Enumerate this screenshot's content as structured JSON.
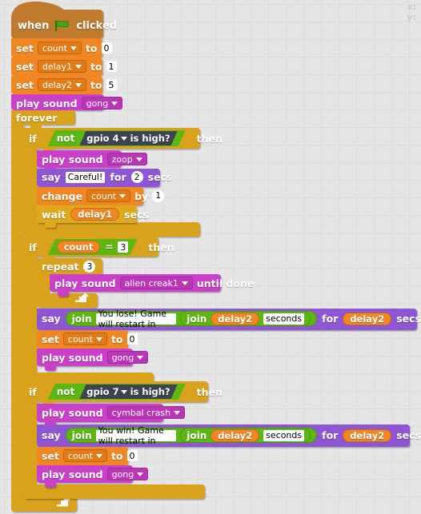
{
  "stage": {
    "x_label": "x:",
    "y_label": "y:",
    "x_value": "",
    "y_value": ""
  },
  "palette_colors": {
    "events_hat": "#bf7a2e",
    "control": "#d9a21c",
    "data": "#f08724",
    "sound": "#cb3fc9",
    "looks": "#8f57d3",
    "operators": "#5cb712",
    "sensing_gpio": "#3d4450",
    "background": "#e5e5e5"
  },
  "script": {
    "hat": {
      "when": "when",
      "icon": "green-flag-icon",
      "clicked": "clicked"
    },
    "set_count_0": {
      "op": "set",
      "var": "count",
      "to": "to",
      "value": "0"
    },
    "set_delay1_1": {
      "op": "set",
      "var": "delay1",
      "to": "to",
      "value": "1"
    },
    "set_delay2_5": {
      "op": "set",
      "var": "delay2",
      "to": "to",
      "value": "5"
    },
    "play_gong_top": {
      "op": "play sound",
      "sound": "gong"
    },
    "forever": {
      "label": "forever"
    },
    "if1": {
      "if": "if",
      "then": "then",
      "not": "not",
      "gpio": "gpio",
      "pin": "4",
      "is_high": "is  high?",
      "play_zoop": {
        "op": "play sound",
        "sound": "zoop"
      },
      "say_careful": {
        "op": "say",
        "message": "Careful!",
        "for": "for",
        "secs_value": "2",
        "secs": "secs"
      },
      "change_count": {
        "op": "change",
        "var": "count",
        "by": "by",
        "value": "1"
      },
      "wait_delay1": {
        "op": "wait",
        "var": "delay1",
        "secs": "secs"
      }
    },
    "if2": {
      "if": "if",
      "then": "then",
      "var": "count",
      "operator": "=",
      "value": "3",
      "repeat": {
        "op": "repeat",
        "times": "3"
      },
      "play_alien": {
        "op": "play sound",
        "sound": "alien creak1",
        "until_done": "until  done"
      },
      "say_lose": {
        "op": "say",
        "join1": "join",
        "text1": "You lose! Game will restart in",
        "join2": "join",
        "var_delay2": "delay2",
        "text2": "seconds",
        "for": "for",
        "for_var": "delay2",
        "secs": "secs"
      },
      "set_count_0": {
        "op": "set",
        "var": "count",
        "to": "to",
        "value": "0"
      },
      "play_gong": {
        "op": "play sound",
        "sound": "gong"
      }
    },
    "if3": {
      "if": "if",
      "then": "then",
      "not": "not",
      "gpio": "gpio",
      "pin": "7",
      "is_high": "is  high?",
      "play_cymbal": {
        "op": "play sound",
        "sound": "cymbal crash"
      },
      "say_win": {
        "op": "say",
        "join1": "join",
        "text1": "You win! Game will restart in",
        "join2": "join",
        "var_delay2": "delay2",
        "text2": "seconds",
        "for": "for",
        "for_var": "delay2",
        "secs": "secs"
      },
      "set_count_0": {
        "op": "set",
        "var": "count",
        "to": "to",
        "value": "0"
      },
      "play_gong": {
        "op": "play sound",
        "sound": "gong"
      }
    }
  }
}
